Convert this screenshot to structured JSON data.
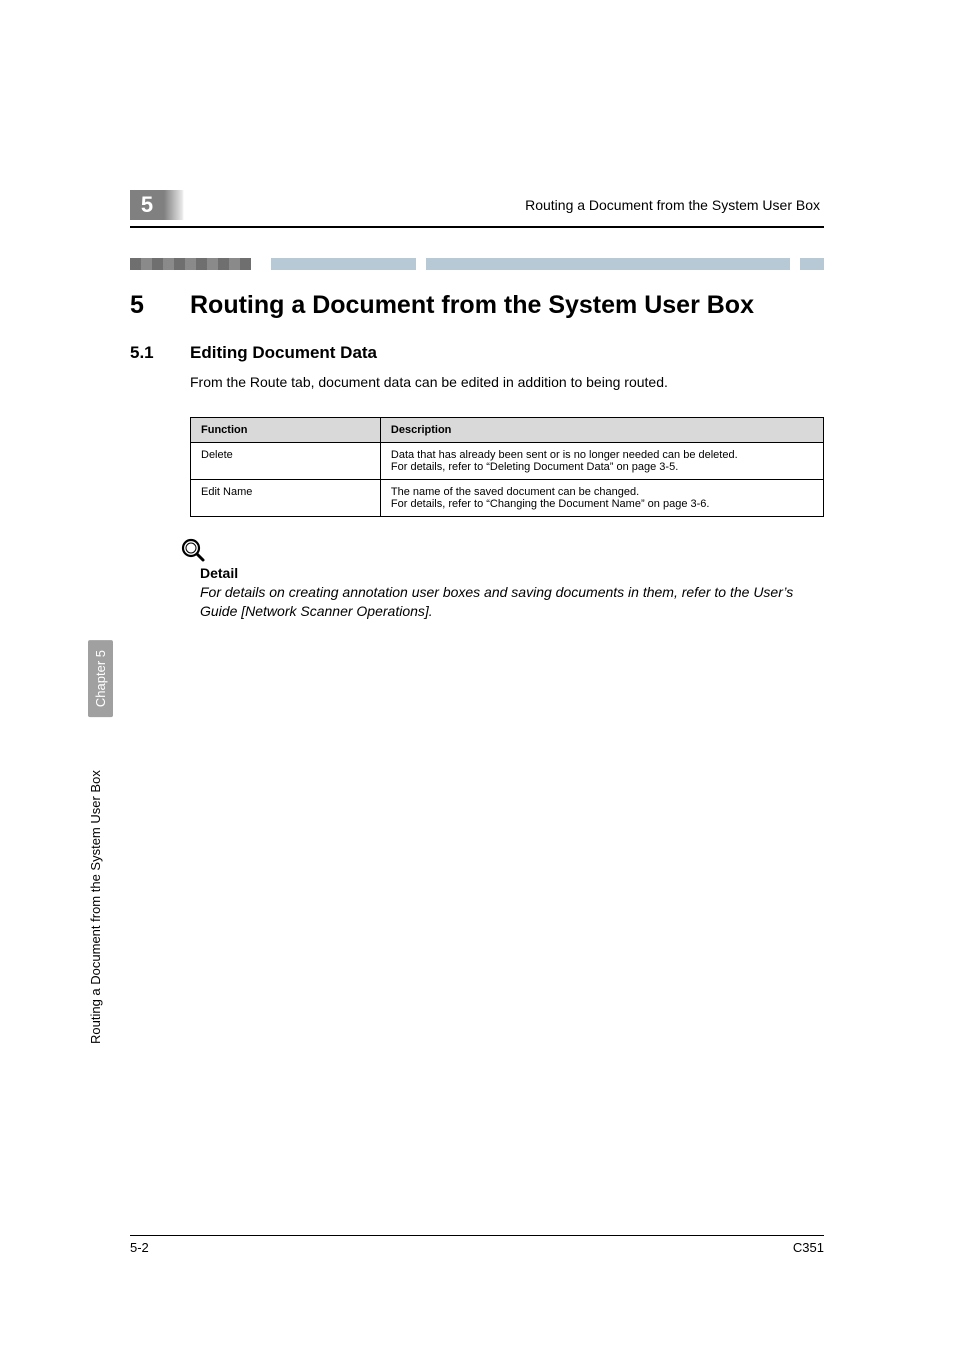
{
  "header": {
    "chapter_number": "5",
    "running_title": "Routing a Document from the System User Box"
  },
  "separator": {},
  "heading": {
    "number": "5",
    "title": "Routing a Document from the System User Box"
  },
  "subheading": {
    "number": "5.1",
    "title": "Editing Document Data"
  },
  "body": {
    "intro": "From the Route tab, document data can be edited in addition to being routed."
  },
  "table": {
    "headers": [
      "Function",
      "Description"
    ],
    "rows": [
      {
        "function": "Delete",
        "description": "Data that has already been sent or is no longer needed can be deleted.\nFor details, refer to “Deleting Document Data” on page 3-5."
      },
      {
        "function": "Edit Name",
        "description": "The name of the saved document can be changed.\nFor details, refer to “Changing the Document Name” on page 3-6."
      }
    ]
  },
  "detail": {
    "label": "Detail",
    "text": "For details on creating annotation user boxes and saving documents in them, refer to the User’s Guide [Network Scanner Operations]."
  },
  "sidebar": {
    "chapter_label": "Chapter 5",
    "section_label": "Routing a Document from the System User Box"
  },
  "footer": {
    "page": "5-2",
    "model": "C351"
  }
}
